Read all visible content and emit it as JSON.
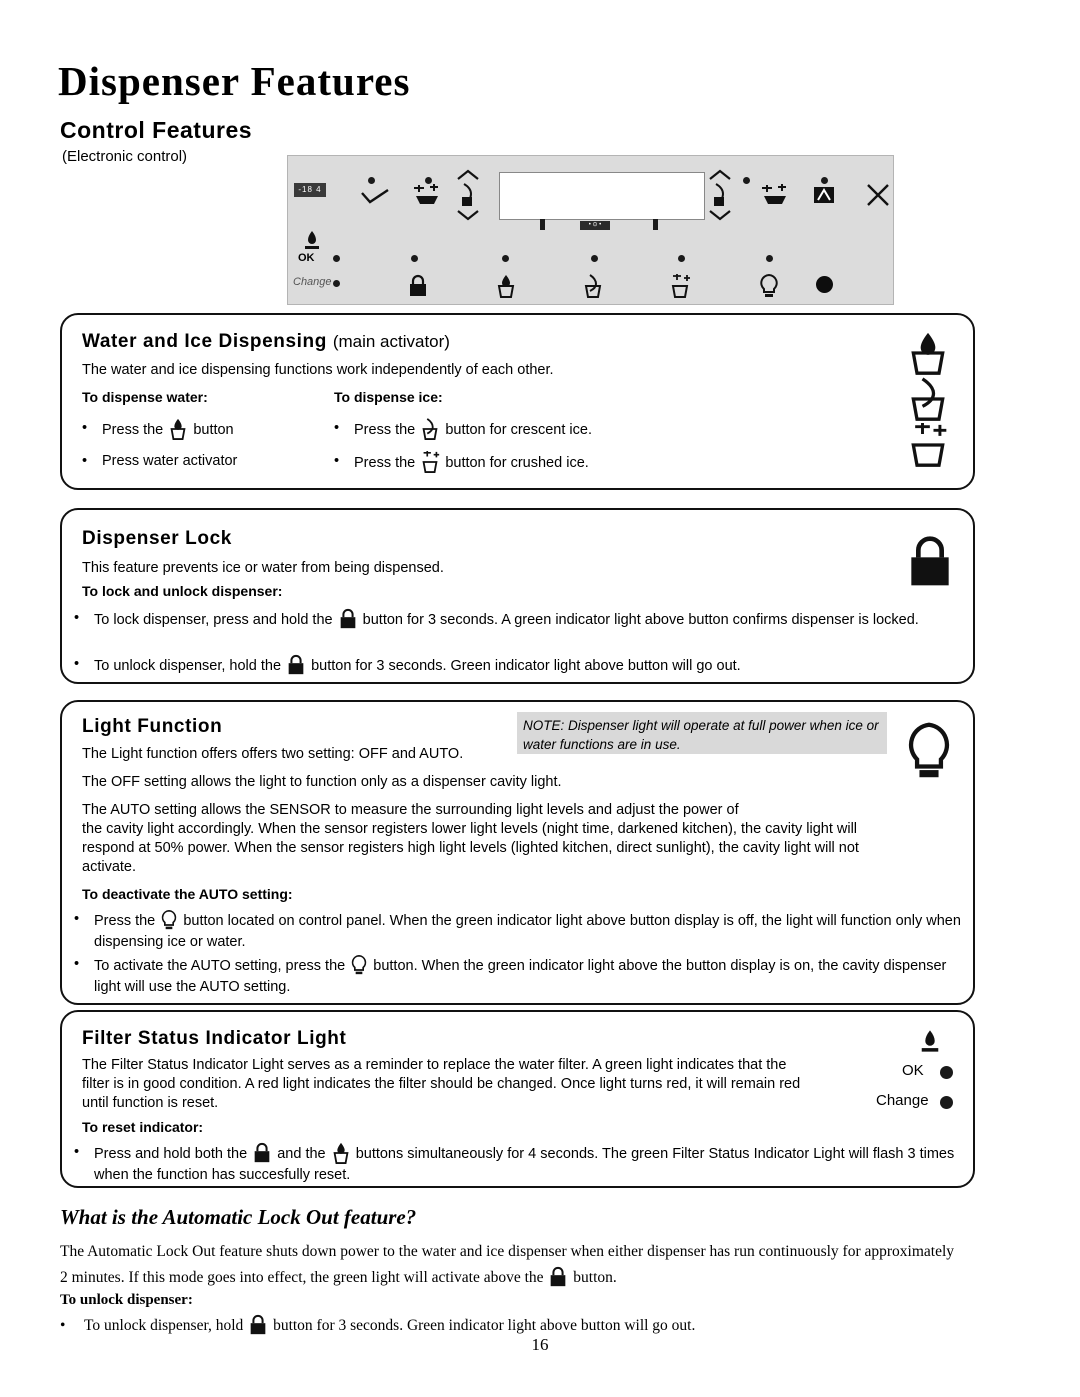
{
  "document": {
    "page_title": "Dispenser Features",
    "section_title": "Control Features",
    "electronic_control": "(Electronic control)",
    "page_number": "16"
  },
  "control_panel": {
    "small_display": "-18 4",
    "ok_label": "OK",
    "change_label": "Change",
    "center_bar_label": "• ⊙ •",
    "icons": [
      "water-drop-icon",
      "check-icon",
      "crushed-ice-icon",
      "cubed-ice-icon",
      "up-chevron-icon",
      "down-chevron-icon",
      "lock-icon",
      "light-bulb-icon",
      "filter-icon",
      "ice-off-icon"
    ]
  },
  "water_ice": {
    "title": "Water and Ice Dispensing",
    "title_sub": "(main activator)",
    "intro": "The water and ice dispensing functions work independently of each other.",
    "water_lead": "To dispense water:",
    "ice_lead": "To dispense ice:",
    "water_bullets": [
      {
        "pre": "Press the",
        "post": "button",
        "icon": "water-dispense-icon"
      },
      {
        "pre": "Press water activator",
        "post": "",
        "icon": ""
      }
    ],
    "ice_bullets": [
      {
        "pre": "Press the",
        "post": "button for crescent ice.",
        "icon": "crescent-ice-icon"
      },
      {
        "pre": "Press the",
        "post": "button for crushed ice.",
        "icon": "crushed-ice-icon"
      }
    ]
  },
  "dispenser_lock": {
    "title": "Dispenser Lock",
    "intro": "This feature prevents ice or water from being dispensed.",
    "lead": "To lock and unlock dispenser:",
    "bullets": [
      {
        "pre": "To lock dispenser, press and hold the",
        "post": "button for 3 seconds. A green indicator light above button confirms dispenser is locked."
      },
      {
        "pre": "To unlock dispenser, hold the",
        "post": "button for 3 seconds. Green indicator light above button will go out."
      }
    ]
  },
  "light_function": {
    "title": "Light Function",
    "note": "NOTE: Dispenser light will operate at full power when ice or water functions are in use.",
    "p1": "The Light function offers offers two setting: OFF and AUTO.",
    "p2": "The OFF setting allows the light to function only as a dispenser cavity light.",
    "p3_a": "The AUTO setting allows the SENSOR to measure the surrounding light levels and adjust the power of",
    "p3_b": "the cavity light accordingly. When the sensor registers lower light levels (night time, darkened kitchen), the cavity light will",
    "p3_c": "respond at 50% power. When the sensor registers high light levels (lighted kitchen, direct sunlight), the cavity light will not",
    "p3_d": "activate.",
    "lead": "To deactivate the AUTO setting:",
    "bullets": [
      {
        "pre": "Press the",
        "post": "button located on control panel. When the green indicator light above button display is off, the light will function only when dispensing ice or water."
      },
      {
        "pre": "To activate the AUTO setting, press the",
        "post": "button. When the green indicator light above the button display is on, the cavity dispenser light will use the AUTO setting."
      }
    ]
  },
  "filter_status": {
    "title": "Filter Status Indicator Light",
    "p1": "The Filter Status Indicator Light serves as a reminder to replace the water filter. A green light indicates that the",
    "p2": "filter is in good condition. A red light indicates the filter should be changed. Once light turns red, it will remain red",
    "p3": "until function is reset.",
    "lead": "To reset indicator:",
    "bullet": {
      "pre": "Press and hold both the",
      "mid": "and the",
      "post": "buttons simultaneously for 4 seconds. The green Filter Status Indicator Light will flash 3 times when the function has succesfully reset."
    },
    "ok_label": "OK",
    "change_label": "Change"
  },
  "auto_lock_out": {
    "title": "What is the Automatic Lock Out feature?",
    "p1": "The Automatic Lock Out feature shuts down power to the water and ice dispenser when either dispenser has run continuously for approximately",
    "p2_pre": "2 minutes. If this mode goes into effect, the  green light will activate above the",
    "p2_post": "button.",
    "lead": "To unlock dispenser:",
    "bullet_pre": "To unlock dispenser, hold",
    "bullet_post": "button for 3 seconds. Green indicator light above button will go out."
  }
}
